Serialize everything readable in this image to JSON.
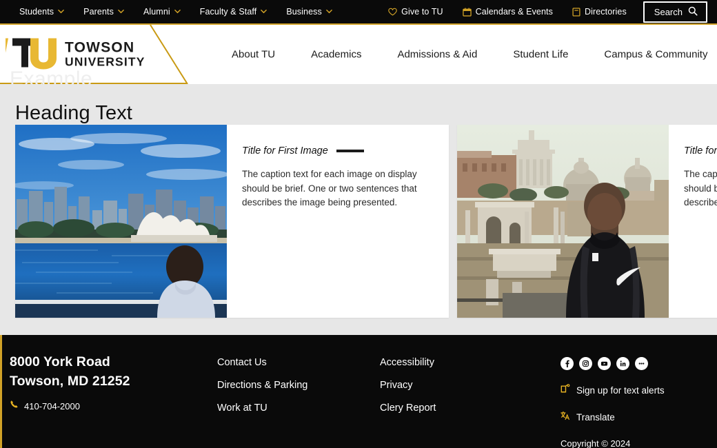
{
  "utility_bar": {
    "left_items": [
      {
        "label": "Students",
        "icon": "chevron-down-icon"
      },
      {
        "label": "Parents",
        "icon": "chevron-down-icon"
      },
      {
        "label": "Alumni",
        "icon": "chevron-down-icon"
      },
      {
        "label": "Faculty & Staff",
        "icon": "chevron-down-icon"
      },
      {
        "label": "Business",
        "icon": "chevron-down-icon"
      }
    ],
    "right_items": [
      {
        "label": "Give to TU",
        "icon": "heart-icon"
      },
      {
        "label": "Calendars & Events",
        "icon": "calendar-icon"
      },
      {
        "label": "Directories",
        "icon": "book-icon"
      }
    ],
    "search_label": "Search",
    "search_icon": "search-icon",
    "accent_color": "#d1a227",
    "background_color": "#0a0a0a"
  },
  "header": {
    "brand": {
      "mark": "tu-logo-icon",
      "line1": "TOWSON",
      "line2": "UNIVERSITY"
    },
    "watermark": "Example",
    "accent_color": "#c99a14",
    "nav_items": [
      {
        "label": "About TU"
      },
      {
        "label": "Academics"
      },
      {
        "label": "Admissions & Aid"
      },
      {
        "label": "Student Life"
      },
      {
        "label": "Campus & Community"
      }
    ]
  },
  "main": {
    "heading": "Heading Text",
    "background_color": "#e7e7e7",
    "cards": [
      {
        "image": "sydney-opera-house-photo",
        "title": "Title for First Image",
        "caption": "The caption text for each image on display should be brief. One or two sentences that describes the image being presented."
      },
      {
        "image": "roman-forum-student-photo",
        "title": "Title for Second Image",
        "caption": "The caption text for each image on display should be brief. One or two sentences that describes the image being presented."
      }
    ]
  },
  "footer": {
    "background_color": "#0a0a0a",
    "accent_color": "#d1a227",
    "address_line1": "8000 York Road",
    "address_line2": "Towson, MD 21252",
    "phone": "410-704-2000",
    "phone_icon": "phone-icon",
    "column1": [
      {
        "label": "Contact Us"
      },
      {
        "label": "Directions & Parking"
      },
      {
        "label": "Work at TU"
      }
    ],
    "column2": [
      {
        "label": "Accessibility"
      },
      {
        "label": "Privacy"
      },
      {
        "label": "Clery Report"
      }
    ],
    "socials": [
      {
        "name": "facebook-icon"
      },
      {
        "name": "instagram-icon"
      },
      {
        "name": "youtube-icon"
      },
      {
        "name": "linkedin-icon"
      },
      {
        "name": "more-icon"
      }
    ],
    "text_alerts_label": "Sign up for text alerts",
    "text_alerts_icon": "text-alert-icon",
    "translate_label": "Translate",
    "translate_icon": "translate-icon",
    "copyright": "Copyright  © 2024"
  }
}
